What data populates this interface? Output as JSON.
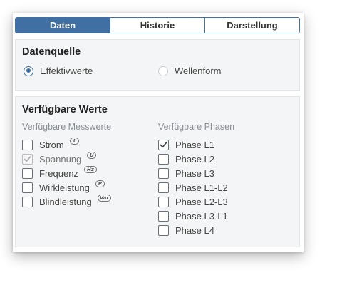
{
  "tabs": [
    {
      "label": "Daten",
      "active": true
    },
    {
      "label": "Historie",
      "active": false
    },
    {
      "label": "Darstellung",
      "active": false
    }
  ],
  "source": {
    "title": "Datenquelle",
    "options": [
      {
        "label": "Effektivwerte",
        "selected": true
      },
      {
        "label": "Wellenform",
        "selected": false
      }
    ]
  },
  "values": {
    "title": "Verfügbare Werte",
    "measurements": {
      "header": "Verfügbare Messwerte",
      "items": [
        {
          "label": "Strom",
          "unit": "I",
          "checked": false,
          "disabled": false
        },
        {
          "label": "Spannung",
          "unit": "U",
          "checked": true,
          "disabled": true
        },
        {
          "label": "Frequenz",
          "unit": "Hz",
          "checked": false,
          "disabled": false
        },
        {
          "label": "Wirkleistung",
          "unit": "P",
          "checked": false,
          "disabled": false
        },
        {
          "label": "Blindleistung",
          "unit": "Var",
          "checked": false,
          "disabled": false
        }
      ]
    },
    "phases": {
      "header": "Verfügbare Phasen",
      "items": [
        {
          "label": "Phase L1",
          "checked": true
        },
        {
          "label": "Phase L2",
          "checked": false
        },
        {
          "label": "Phase L3",
          "checked": false
        },
        {
          "label": "Phase L1-L2",
          "checked": false
        },
        {
          "label": "Phase L2-L3",
          "checked": false
        },
        {
          "label": "Phase L3-L1",
          "checked": false
        },
        {
          "label": "Phase L4",
          "checked": false
        }
      ]
    }
  },
  "colors": {
    "accent": "#3f6fa3",
    "panel_bg": "#f4f5f6",
    "muted_text": "#8a8e94"
  }
}
